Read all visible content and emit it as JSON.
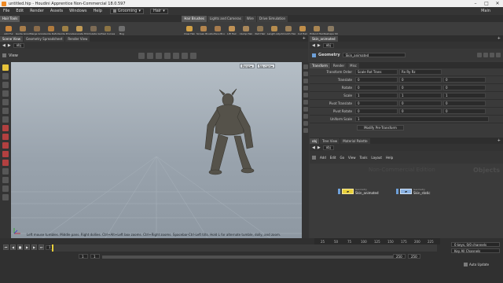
{
  "window": {
    "title": "untitled.hip - Houdini Apprentice Non-Commercial 18.0.597"
  },
  "menu": {
    "items": [
      "File",
      "Edit",
      "Render",
      "Assets",
      "Windows",
      "Help"
    ],
    "desktop": "Grooming",
    "obj_path": "Hair",
    "user": "Main"
  },
  "shelf": {
    "tabs_left": [
      "Hair Tools"
    ],
    "tabs_right": [
      "Hair Brushes",
      "Lights and Cameras",
      "Wire",
      "Drive Simulation"
    ],
    "tools_left": [
      {
        "label": "Add Fur",
        "color": "#c9853c"
      },
      {
        "label": "Guide Groom",
        "color": "#a77d4b"
      },
      {
        "label": "Merge Groom",
        "color": "#8a6b4a"
      },
      {
        "label": "Guide Deform",
        "color": "#b07b3e"
      },
      {
        "label": "Guide Process",
        "color": "#9d8046"
      },
      {
        "label": "Generate Hair",
        "color": "#c19a55"
      },
      {
        "label": "Simulate Guides",
        "color": "#7d6b55"
      },
      {
        "label": "Pixel Curves",
        "color": "#8c7444"
      },
      {
        "label": "Bug",
        "color": "#6f6f6f"
      }
    ],
    "tools_right": [
      {
        "label": "Draw Hair",
        "color": "#d1a046"
      },
      {
        "label": "Screen Brush",
        "color": "#b4854e"
      },
      {
        "label": "Surface Brush",
        "color": "#a77b4d"
      },
      {
        "label": "Lift Hair",
        "color": "#c09256"
      },
      {
        "label": "Clump Hair",
        "color": "#a9875a"
      },
      {
        "label": "Part Hair",
        "color": "#8d7553"
      },
      {
        "label": "Length Adjust",
        "color": "#b68c4e"
      },
      {
        "label": "Smooth Hair",
        "color": "#9b7f58"
      },
      {
        "label": "Cut Hair",
        "color": "#c08e4a"
      },
      {
        "label": "Extend Hair",
        "color": "#a98552"
      },
      {
        "label": "Reshape Strands",
        "color": "#8a7a62"
      }
    ]
  },
  "left_pane": {
    "tabs": [
      "Scene View",
      "Geometry Spreadsheet",
      "Render View"
    ],
    "path": "obj",
    "view_label": "View",
    "persp": "Persp",
    "cam": "No cam",
    "status": "Left mouse tumbles. Middle pans. Right dollies. Ctrl+Alt+Left box zooms. Ctrl+Right zooms. Spacebar-Ctrl-Left tilts. Hold L for alternate tumble, dolly, and zoom."
  },
  "params": {
    "tab": "Skin_animated",
    "path": "obj",
    "node_type": "Geometry",
    "node_name": "Skin_animated",
    "subtabs": [
      "Transform",
      "Render",
      "Misc"
    ],
    "transform_order_label": "Transform Order",
    "transform_order": "Scale Rot Trans",
    "rot_order": "Rx Ry Rz",
    "rows": [
      {
        "label": "Translate",
        "values": [
          "0",
          "0",
          "0"
        ]
      },
      {
        "label": "Rotate",
        "values": [
          "0",
          "0",
          "0"
        ]
      },
      {
        "label": "Scale",
        "values": [
          "1",
          "1",
          "1"
        ]
      },
      {
        "label": "Pivot Translate",
        "values": [
          "0",
          "0",
          "0"
        ]
      },
      {
        "label": "Pivot Rotate",
        "values": [
          "0",
          "0",
          "0"
        ]
      },
      {
        "label": "Uniform Scale",
        "values": [
          "1"
        ]
      }
    ],
    "modify_btn": "Modify Pre-Transform"
  },
  "network": {
    "tabs": [
      "obj",
      "Tree View",
      "Material Palette"
    ],
    "path": "obj",
    "menu": [
      "Add",
      "Edit",
      "Go",
      "View",
      "Tools",
      "Layout",
      "Help"
    ],
    "watermark": "Non-Commercial Edition",
    "context": "Objects",
    "nodes": [
      {
        "type": "Geometry",
        "name": "Skin_animated"
      },
      {
        "type": "Geometry",
        "name": "Skin_static"
      }
    ]
  },
  "timeline": {
    "frame": "1",
    "start": "1",
    "end": "1",
    "range_start": "250",
    "range_end": "250",
    "ticks": [
      "25",
      "50",
      "75",
      "100",
      "125",
      "150",
      "175",
      "200",
      "225"
    ],
    "keys_info": "0 keys, 0/0 channels",
    "key_all": "Key All Channels",
    "auto_update": "Auto Update"
  },
  "colors": {
    "accent": "#e8cf3a",
    "viewport_sky": "#b5bec6",
    "node_blue": "#8ab2e3"
  }
}
